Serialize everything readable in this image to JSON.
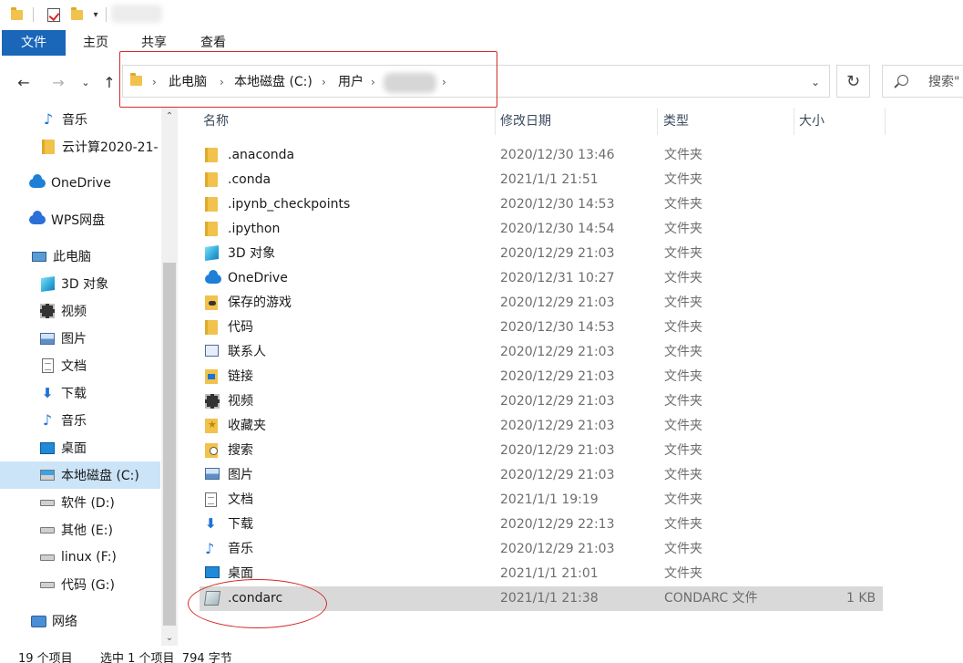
{
  "ribbon": {
    "tabs": [
      "文件",
      "主页",
      "共享",
      "查看"
    ]
  },
  "address": {
    "crumbs": [
      "此电脑",
      "本地磁盘 (C:)",
      "用户"
    ],
    "search_placeholder": "搜索\""
  },
  "sidebar": {
    "items": [
      {
        "label": "音乐",
        "icon": "music-note-icon"
      },
      {
        "label": "云计算2020-21-",
        "icon": "folder-icon"
      },
      {
        "label": "OneDrive",
        "icon": "onedrive-cloud-icon"
      },
      {
        "label": "WPS网盘",
        "icon": "wps-cloud-icon"
      },
      {
        "label": "此电脑",
        "icon": "this-pc-icon"
      },
      {
        "label": "3D 对象",
        "icon": "3d-objects-icon"
      },
      {
        "label": "视频",
        "icon": "video-film-icon"
      },
      {
        "label": "图片",
        "icon": "pictures-icon"
      },
      {
        "label": "文档",
        "icon": "documents-icon"
      },
      {
        "label": "下载",
        "icon": "download-arrow-icon"
      },
      {
        "label": "音乐",
        "icon": "music-note-icon"
      },
      {
        "label": "桌面",
        "icon": "desktop-icon"
      },
      {
        "label": "本地磁盘 (C:)",
        "icon": "drive-c-icon",
        "selected": true
      },
      {
        "label": "软件 (D:)",
        "icon": "drive-icon"
      },
      {
        "label": "其他 (E:)",
        "icon": "drive-icon"
      },
      {
        "label": "linux (F:)",
        "icon": "drive-icon"
      },
      {
        "label": "代码 (G:)",
        "icon": "drive-icon"
      },
      {
        "label": "网络",
        "icon": "network-icon"
      }
    ]
  },
  "columns": [
    "名称",
    "修改日期",
    "类型",
    "大小"
  ],
  "files": [
    {
      "name": ".anaconda",
      "date": "2020/12/30 13:46",
      "type": "文件夹",
      "size": "",
      "icon": "folder-icon"
    },
    {
      "name": ".conda",
      "date": "2021/1/1 21:51",
      "type": "文件夹",
      "size": "",
      "icon": "folder-icon"
    },
    {
      "name": ".ipynb_checkpoints",
      "date": "2020/12/30 14:53",
      "type": "文件夹",
      "size": "",
      "icon": "folder-icon"
    },
    {
      "name": ".ipython",
      "date": "2020/12/30 14:54",
      "type": "文件夹",
      "size": "",
      "icon": "folder-icon"
    },
    {
      "name": "3D 对象",
      "date": "2020/12/29 21:03",
      "type": "文件夹",
      "size": "",
      "icon": "3d-objects-icon"
    },
    {
      "name": "OneDrive",
      "date": "2020/12/31 10:27",
      "type": "文件夹",
      "size": "",
      "icon": "onedrive-cloud-icon"
    },
    {
      "name": "保存的游戏",
      "date": "2020/12/29 21:03",
      "type": "文件夹",
      "size": "",
      "icon": "saved-games-icon"
    },
    {
      "name": "代码",
      "date": "2020/12/30 14:53",
      "type": "文件夹",
      "size": "",
      "icon": "folder-icon"
    },
    {
      "name": "联系人",
      "date": "2020/12/29 21:03",
      "type": "文件夹",
      "size": "",
      "icon": "contacts-icon"
    },
    {
      "name": "链接",
      "date": "2020/12/29 21:03",
      "type": "文件夹",
      "size": "",
      "icon": "links-icon"
    },
    {
      "name": "视频",
      "date": "2020/12/29 21:03",
      "type": "文件夹",
      "size": "",
      "icon": "video-film-icon"
    },
    {
      "name": "收藏夹",
      "date": "2020/12/29 21:03",
      "type": "文件夹",
      "size": "",
      "icon": "favorites-icon"
    },
    {
      "name": "搜索",
      "date": "2020/12/29 21:03",
      "type": "文件夹",
      "size": "",
      "icon": "searches-icon"
    },
    {
      "name": "图片",
      "date": "2020/12/29 21:03",
      "type": "文件夹",
      "size": "",
      "icon": "pictures-icon"
    },
    {
      "name": "文档",
      "date": "2021/1/1 19:19",
      "type": "文件夹",
      "size": "",
      "icon": "documents-icon"
    },
    {
      "name": "下载",
      "date": "2020/12/29 22:13",
      "type": "文件夹",
      "size": "",
      "icon": "download-arrow-icon"
    },
    {
      "name": "音乐",
      "date": "2020/12/29 21:03",
      "type": "文件夹",
      "size": "",
      "icon": "music-note-icon"
    },
    {
      "name": "桌面",
      "date": "2021/1/1 21:01",
      "type": "文件夹",
      "size": "",
      "icon": "desktop-icon"
    },
    {
      "name": ".condarc",
      "date": "2021/1/1 21:38",
      "type": "CONDARC 文件",
      "size": "1 KB",
      "icon": "condarc-file-icon",
      "selected": true
    }
  ],
  "status": {
    "count": "19 个项目",
    "selection": "选中 1 个项目  794 字节"
  },
  "colors": {
    "file_tab": "#1a66b8",
    "selection": "#cce4f7",
    "row_selected": "#d9d9d9",
    "annotation_red": "#d42a2a"
  }
}
